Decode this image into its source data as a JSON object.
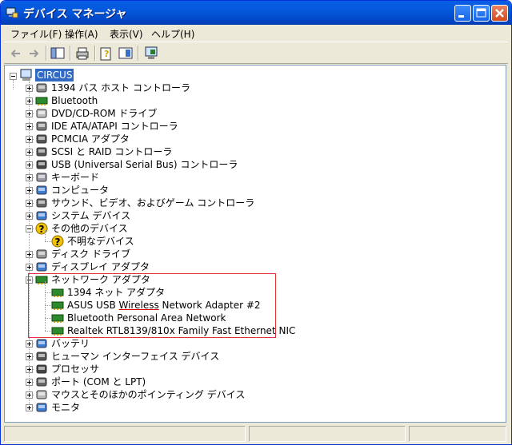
{
  "window": {
    "title": "デバイス マネージャ"
  },
  "menubar": {
    "file": "ファイル(F)",
    "action": "操作(A)",
    "view": "表示(V)",
    "help": "ヘルプ(H)"
  },
  "tree": {
    "root": "CIRCUS",
    "categories": [
      {
        "label": "1394 バス ホスト コントローラ",
        "icon": "1394-icon",
        "expanded": false
      },
      {
        "label": "Bluetooth",
        "icon": "bluetooth-icon",
        "expanded": false
      },
      {
        "label": "DVD/CD-ROM ドライブ",
        "icon": "cdrom-icon",
        "expanded": false
      },
      {
        "label": "IDE ATA/ATAPI コントローラ",
        "icon": "ide-icon",
        "expanded": false
      },
      {
        "label": "PCMCIA アダプタ",
        "icon": "pcmcia-icon",
        "expanded": false
      },
      {
        "label": "SCSI と RAID コントローラ",
        "icon": "scsi-icon",
        "expanded": false
      },
      {
        "label": "USB (Universal Serial Bus) コントローラ",
        "icon": "usb-icon",
        "expanded": false
      },
      {
        "label": "キーボード",
        "icon": "keyboard-icon",
        "expanded": false
      },
      {
        "label": "コンピュータ",
        "icon": "computer-icon",
        "expanded": false
      },
      {
        "label": "サウンド、ビデオ、およびゲーム コントローラ",
        "icon": "sound-icon",
        "expanded": false
      },
      {
        "label": "システム デバイス",
        "icon": "system-icon",
        "expanded": false
      },
      {
        "label": "その他のデバイス",
        "icon": "question-icon",
        "expanded": true
      },
      {
        "label": "不明なデバイス",
        "icon": "unknown-device-icon",
        "child": true
      },
      {
        "label": "ディスク ドライブ",
        "icon": "disk-icon",
        "expanded": false
      },
      {
        "label": "ディスプレイ アダプタ",
        "icon": "display-icon",
        "expanded": false
      },
      {
        "label": "ネットワーク アダプタ",
        "icon": "network-icon",
        "expanded": true
      },
      {
        "label": "1394 ネット アダプタ",
        "icon": "network-icon",
        "child": true
      },
      {
        "label_pre": "ASUS USB ",
        "label_under": "Wireless",
        "label_post": " Network Adapter #2",
        "icon": "network-icon",
        "child": true
      },
      {
        "label": "Bluetooth Personal Area Network",
        "icon": "network-icon",
        "child": true
      },
      {
        "label": "Realtek RTL8139/810x Family Fast Ethernet NIC",
        "icon": "network-icon",
        "child": true
      },
      {
        "label": "バッテリ",
        "icon": "battery-icon",
        "expanded": false
      },
      {
        "label": "ヒューマン インターフェイス デバイス",
        "icon": "hid-icon",
        "expanded": false
      },
      {
        "label": "プロセッサ",
        "icon": "processor-icon",
        "expanded": false
      },
      {
        "label": "ポート (COM と LPT)",
        "icon": "port-icon",
        "expanded": false
      },
      {
        "label": "マウスとそのほかのポインティング デバイス",
        "icon": "mouse-icon",
        "expanded": false
      },
      {
        "label": "モニタ",
        "icon": "monitor-icon",
        "expanded": false
      }
    ]
  },
  "colors": {
    "selection": "#316ac5",
    "highlight_box": "#e0303a",
    "titlebar": "#0458dc"
  }
}
